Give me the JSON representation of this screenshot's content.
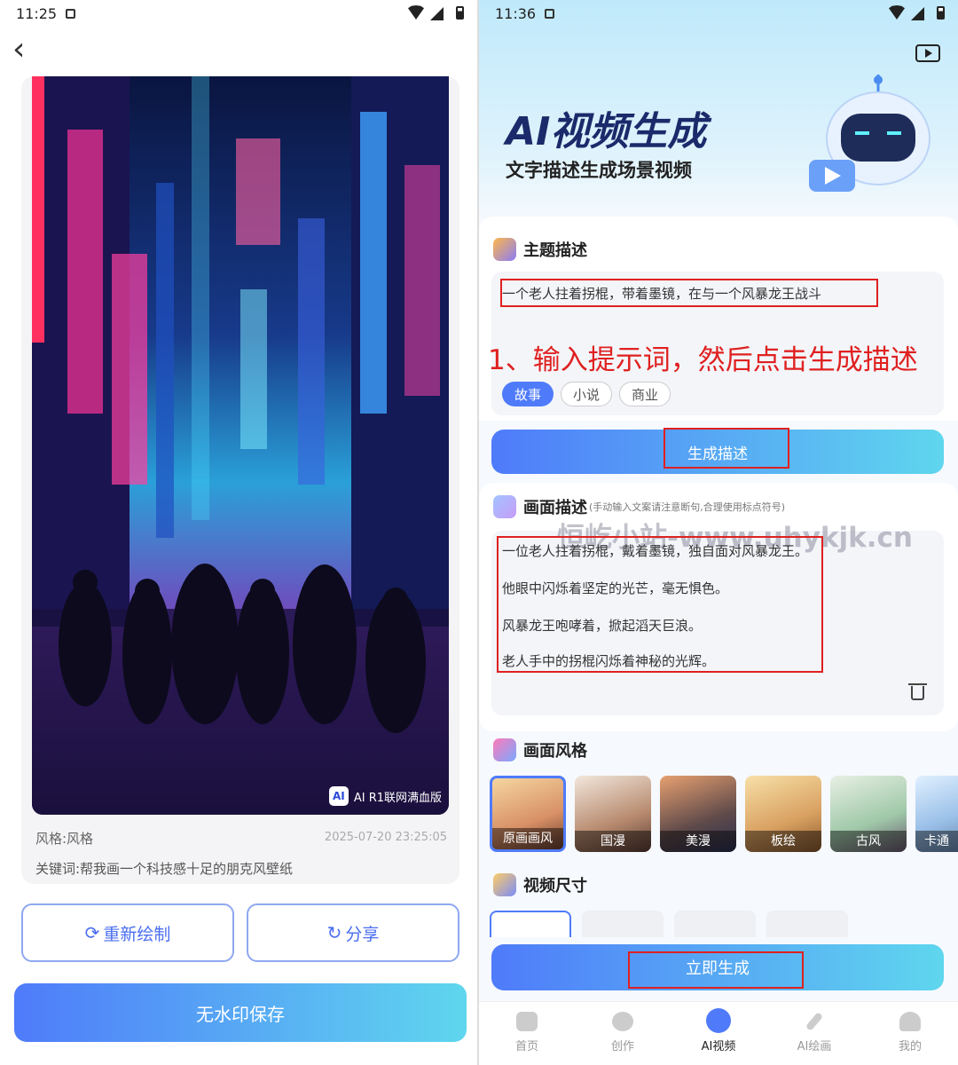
{
  "left_screen": {
    "status_bar": {
      "time": "11:25"
    },
    "back_label": "‹",
    "image": {
      "badge_logo": "AI",
      "badge_text": "AI R1联网满血版"
    },
    "meta": {
      "style": "风格:风格",
      "timestamp": "2025-07-20 23:25:05",
      "keywords": "关键词:帮我画一个科技感十足的朋克风壁纸"
    },
    "buttons": {
      "redraw": "重新绘制",
      "share": "分享",
      "save": "无水印保存"
    }
  },
  "right_screen": {
    "status_bar": {
      "time": "11:36"
    },
    "banner": {
      "title": "AI视频生成",
      "subtitle": "文字描述生成场景视频"
    },
    "topic": {
      "title": "主题描述",
      "input_value": "一个老人拄着拐棍，带着墨镜，在与一个风暴龙王战斗",
      "annotation": "1、输入提示词，然后点击生成描述",
      "chips": [
        "故事",
        "小说",
        "商业"
      ]
    },
    "generate_desc_button": "生成描述",
    "scene": {
      "title": "画面描述",
      "hint": "(手动输入文案请注意断句,合理使用标点符号)",
      "watermark": "恒屹小站-www.uhykjk.cn",
      "lines": [
        "一位老人拄着拐棍，戴着墨镜，独自面对风暴龙王。",
        "他眼中闪烁着坚定的光芒，毫无惧色。",
        "风暴龙王咆哮着，掀起滔天巨浪。",
        "老人手中的拐棍闪烁着神秘的光辉。"
      ]
    },
    "style_section": {
      "title": "画面风格",
      "styles": [
        "原画画风",
        "国漫",
        "美漫",
        "板绘",
        "古风",
        "卡通"
      ]
    },
    "size_section": {
      "title": "视频尺寸"
    },
    "generate_now_button": "立即生成",
    "tabs": [
      "首页",
      "创作",
      "AI视频",
      "AI绘画",
      "我的"
    ],
    "active_tab": "AI视频",
    "colors": {
      "accent": "#4f7bfa",
      "annotation_red": "#e02020"
    }
  }
}
